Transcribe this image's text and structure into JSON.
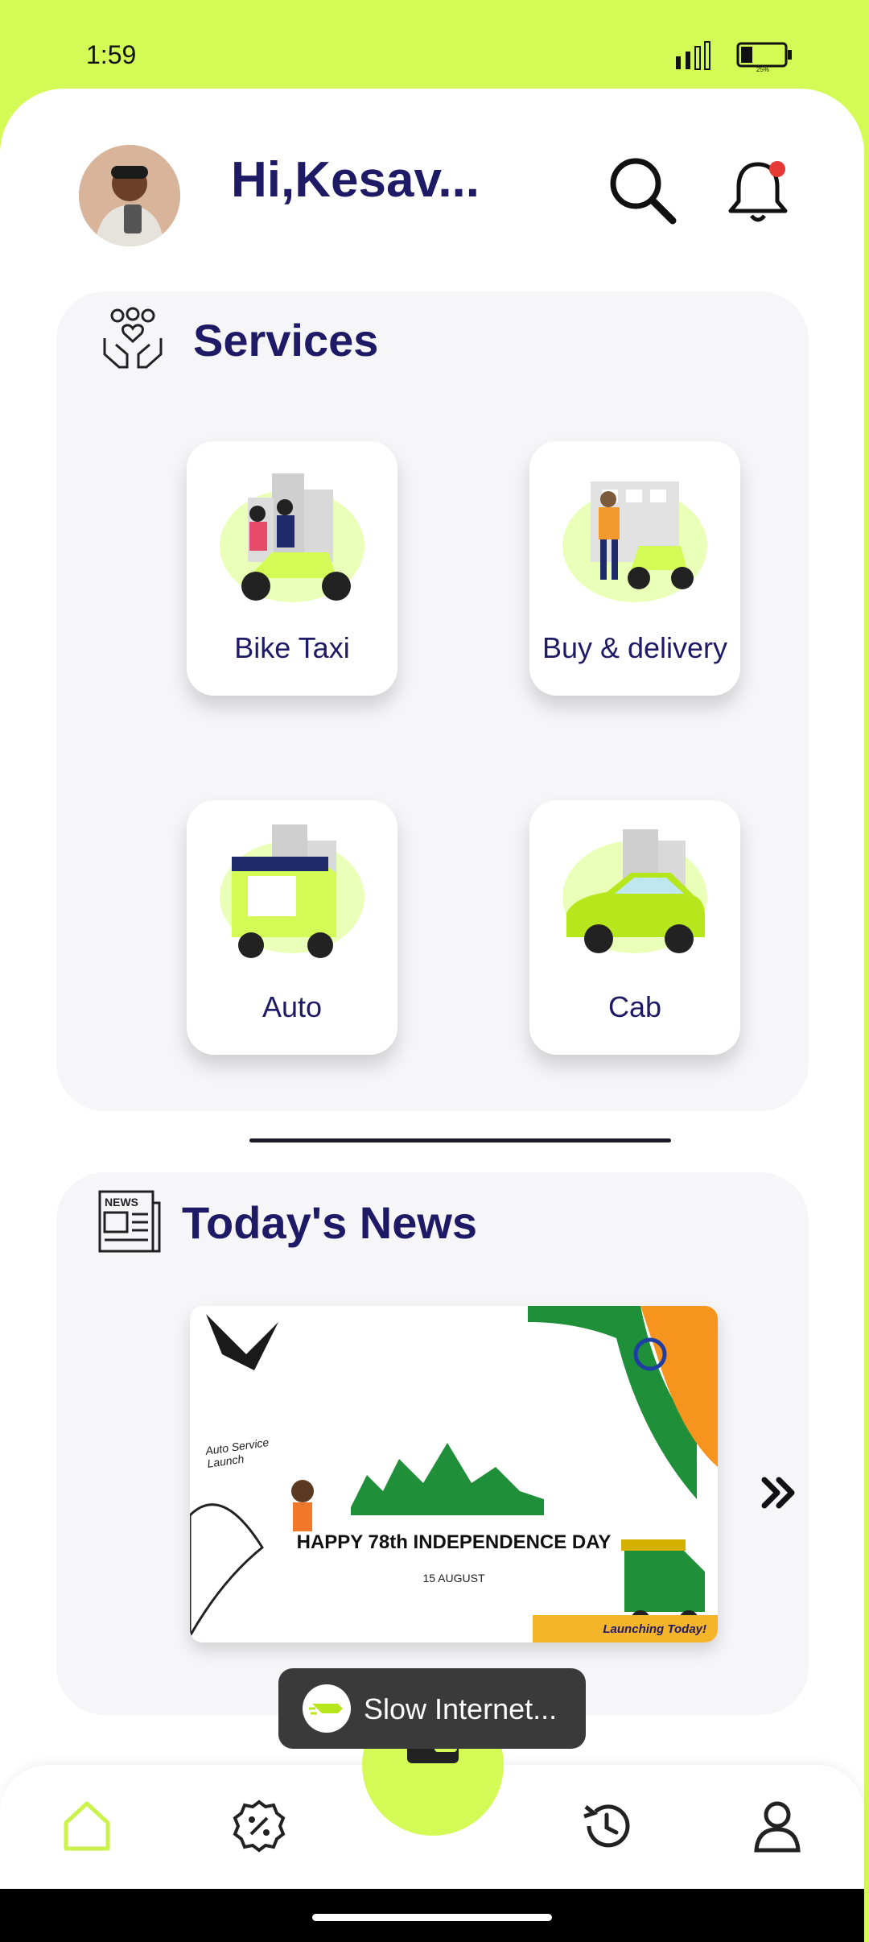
{
  "status_bar": {
    "time": "1:59",
    "battery_level": "25%"
  },
  "header": {
    "greeting": "Hi,Kesav..."
  },
  "services": {
    "title": "Services",
    "items": [
      {
        "label": "Bike Taxi"
      },
      {
        "label": "Buy & delivery"
      },
      {
        "label": "Auto"
      },
      {
        "label": "Cab"
      }
    ]
  },
  "news": {
    "title": "Today's News",
    "card": {
      "headline": "HAPPY 78th INDEPENDENCE DAY",
      "date": "15 AUGUST",
      "left_tag": "Auto Service Launch",
      "right_tag": "Launching Today!"
    }
  },
  "toast": {
    "text": "Slow Internet..."
  },
  "colors": {
    "accent": "#d4fb55",
    "title": "#1f1a66",
    "notification_dot": "#e53935"
  }
}
